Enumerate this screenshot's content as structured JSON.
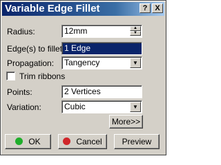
{
  "window": {
    "title": "Variable Edge Fillet",
    "help_btn": "?",
    "close_btn": "X"
  },
  "radius": {
    "label": "Radius:",
    "value": "12mm"
  },
  "edges": {
    "label": "Edge(s) to fillet:",
    "value": "1 Edge"
  },
  "propagation": {
    "label": "Propagation:",
    "value": "Tangency"
  },
  "trim": {
    "label": "Trim ribbons",
    "checked": false
  },
  "points": {
    "label": "Points:",
    "value": "2 Vertices"
  },
  "variation": {
    "label": "Variation:",
    "value": "Cubic"
  },
  "buttons": {
    "more": "More>>",
    "ok": "OK",
    "cancel": "Cancel",
    "preview": "Preview"
  },
  "colors": {
    "ok_indicator": "#1fae2b",
    "cancel_indicator": "#d0262a",
    "title_bar": "#0a246a"
  },
  "icons": {
    "spin": "up-down-arrows",
    "dropdown": "chevron-down-icon"
  }
}
